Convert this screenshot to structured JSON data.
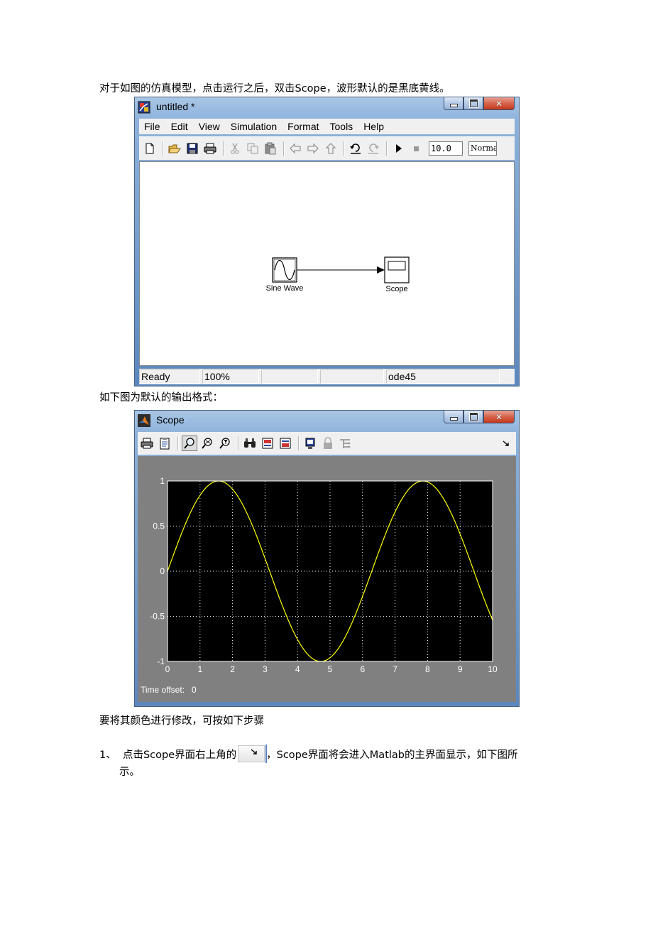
{
  "doc": {
    "para1": "对于如图的仿真模型，点击运行之后，双击Scope，波形默认的是黑底黄线。",
    "para2": "如下图为默认的输出格式：",
    "para3": "要将其颜色进行修改，可按如下步骤",
    "step_number": "1、",
    "step1_before": "点击Scope界面右上角的",
    "step1_after": "，Scope界面将会进入Matlab的主界面显示，如下图所",
    "step1_cont": "示。",
    "inline_button_icon": "dock-arrow-icon"
  },
  "simulink_window": {
    "title": "untitled *",
    "menu": [
      "File",
      "Edit",
      "View",
      "Simulation",
      "Format",
      "Tools",
      "Help"
    ],
    "toolbar_icons": [
      "new-icon",
      "open-icon",
      "save-icon",
      "print-icon",
      "cut-icon",
      "copy-icon",
      "paste-icon",
      "back-icon",
      "forward-icon",
      "up-icon",
      "undo-icon",
      "redo-icon",
      "play-icon",
      "stop-icon"
    ],
    "stop_time": "10.0",
    "sim_mode": "Normal",
    "blocks": {
      "source_label": "Sine Wave",
      "sink_label": "Scope"
    },
    "status": {
      "state": "Ready",
      "zoom": "100%",
      "cell3": "",
      "cell4": "",
      "solver": "ode45"
    }
  },
  "scope_window": {
    "title": "Scope",
    "toolbar_icons": [
      "print-icon",
      "parameters-icon",
      "zoom-icon",
      "zoom-x-icon",
      "zoom-y-icon",
      "autoscale-icon",
      "save-axes-icon",
      "restore-axes-icon",
      "floating-scope-icon",
      "lock-icon",
      "signal-selector-icon",
      "undock-icon"
    ],
    "time_offset_label": "Time offset:",
    "time_offset_value": "0",
    "colors": {
      "plot_background": "#000000",
      "trace": "#ffff00",
      "frame": "#808080",
      "grid": "#ffffff"
    }
  },
  "chart_data": {
    "type": "line",
    "x": [
      0,
      0.25,
      0.5,
      0.75,
      1,
      1.25,
      1.5,
      1.75,
      2,
      2.25,
      2.5,
      2.75,
      3,
      3.25,
      3.5,
      3.75,
      4,
      4.25,
      4.5,
      4.75,
      5,
      5.25,
      5.5,
      5.75,
      6,
      6.25,
      6.5,
      6.75,
      7,
      7.25,
      7.5,
      7.75,
      8,
      8.25,
      8.5,
      8.75,
      9,
      9.25,
      9.5,
      9.75,
      10
    ],
    "series": [
      {
        "values": [
          0,
          0.247,
          0.479,
          0.682,
          0.841,
          0.949,
          0.997,
          0.984,
          0.909,
          0.778,
          0.598,
          0.382,
          0.141,
          -0.108,
          -0.351,
          -0.572,
          -0.757,
          -0.895,
          -0.978,
          -0.999,
          -0.959,
          -0.859,
          -0.706,
          -0.508,
          -0.279,
          -0.033,
          0.215,
          0.451,
          0.657,
          0.823,
          0.938,
          0.994,
          0.989,
          0.923,
          0.798,
          0.624,
          0.412,
          0.174,
          -0.075,
          -0.319,
          -0.544
        ]
      }
    ],
    "xticks": [
      "0",
      "1",
      "2",
      "3",
      "4",
      "5",
      "6",
      "7",
      "8",
      "9",
      "10"
    ],
    "yticks": [
      "-1",
      "-0.5",
      "0",
      "0.5",
      "1"
    ],
    "xlim": [
      0,
      10
    ],
    "ylim": [
      -1,
      1
    ],
    "grid": true,
    "legend": "none"
  }
}
